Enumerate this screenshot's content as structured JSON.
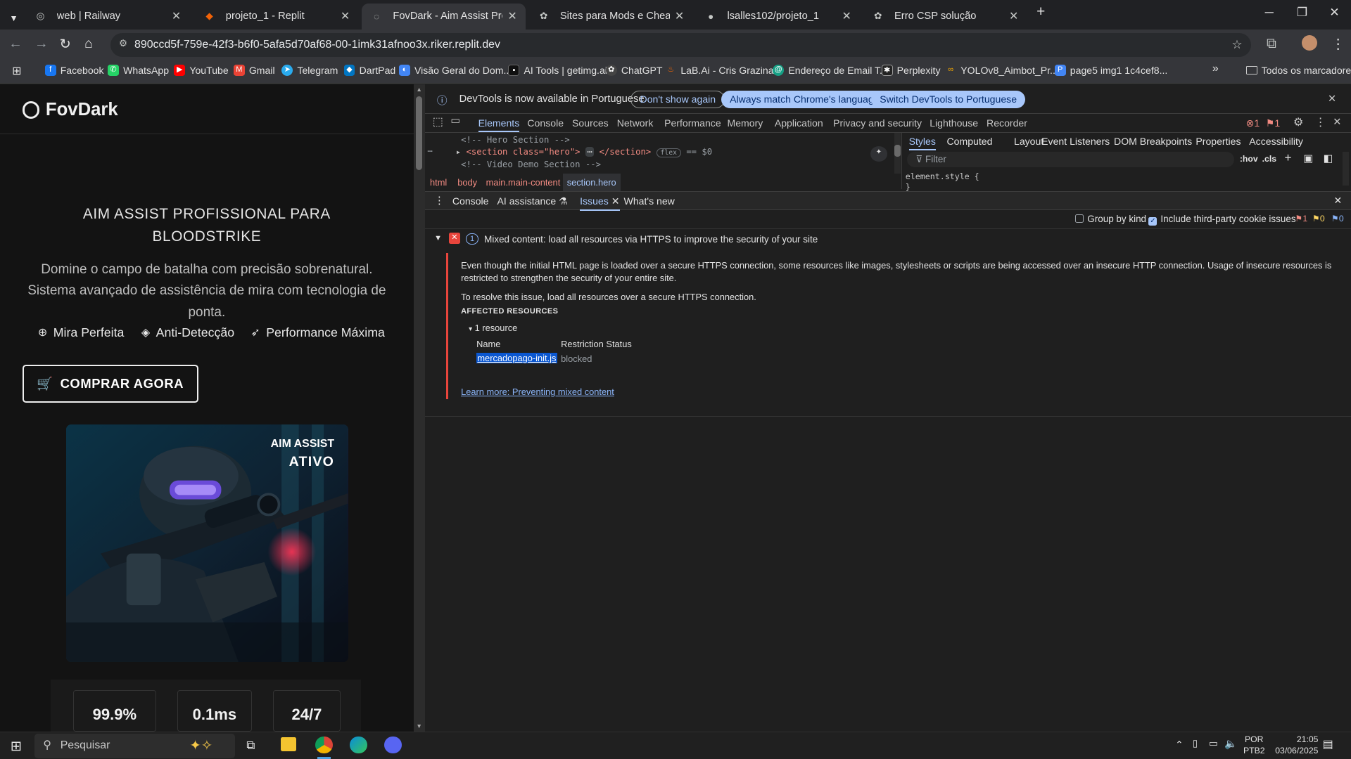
{
  "browser": {
    "tabs": [
      {
        "title": "web | Railway",
        "icon": "railway-icon"
      },
      {
        "title": "projeto_1 - Replit",
        "icon": "replit-icon"
      },
      {
        "title": "FovDark - Aim Assist Profission...",
        "icon": "globe-icon",
        "active": true
      },
      {
        "title": "Sites para Mods e Cheats",
        "icon": "chatgpt-icon"
      },
      {
        "title": "lsalles102/projeto_1",
        "icon": "github-icon"
      },
      {
        "title": "Erro CSP solução",
        "icon": "chatgpt-icon"
      }
    ],
    "url": "890ccd5f-759e-42f3-b6f0-5afa5d70af68-00-1imk31afnoo3x.riker.replit.dev",
    "bookmarks": [
      "Facebook",
      "WhatsApp",
      "YouTube",
      "Gmail",
      "Telegram",
      "DartPad",
      "Visão Geral do Dom...",
      "AI Tools | getimg.ai",
      "ChatGPT",
      "LaB.Ai - Cris Grazina...",
      "Endereço de Email T...",
      "Perplexity",
      "YOLOv8_Aimbot_Pr...",
      "page5 img1 1c4cef8...",
      "Todos os marcadores"
    ]
  },
  "site": {
    "logo": "FovDark",
    "hero_title": "AIM ASSIST PROFISSIONAL PARA BLOODSTRIKE",
    "hero_subtitle": "Domine o campo de batalha com precisão sobrenatural. Sistema avançado de assistência de mira com tecnologia de ponta.",
    "features": [
      "Mira Perfeita",
      "Anti-Detecção",
      "Performance Máxima"
    ],
    "buy_button": "COMPRAR AGORA",
    "image_overlay_line1": "AIM ASSIST",
    "image_overlay_line2": "ATIVO",
    "stats": [
      "99.9%",
      "0.1ms",
      "24/7"
    ]
  },
  "devtools": {
    "infobar_text": "DevTools is now available in Portuguese",
    "btn_dont_show": "Don't show again",
    "btn_match_lang": "Always match Chrome's language",
    "btn_switch": "Switch DevTools to Portuguese",
    "main_tabs": [
      "Elements",
      "Console",
      "Sources",
      "Network",
      "Performance",
      "Memory",
      "Application",
      "Privacy and security",
      "Lighthouse",
      "Recorder"
    ],
    "error_count": "1",
    "issue_count": "1",
    "dom_line1": "<!-- Hero Section -->",
    "dom_line2_tag": "<section class=\"hero\">",
    "dom_line2_end": "</section>",
    "dom_line2_badge": "flex",
    "dom_line2_eq": "== $0",
    "dom_line3": "<!-- Video Demo Section -->",
    "breadcrumbs": [
      "html",
      "body",
      "main.main-content",
      "section.hero"
    ],
    "style_tabs": [
      "Styles",
      "Computed",
      "Layout",
      "Event Listeners",
      "DOM Breakpoints",
      "Properties",
      "Accessibility"
    ],
    "filter_placeholder": "Filter",
    "hov": ":hov",
    "cls": ".cls",
    "element_style": "element.style {",
    "element_style_close": "}",
    "drawer_tabs": [
      "Console",
      "AI assistance",
      "Issues",
      "What's new"
    ],
    "group_by_kind": "Group by kind",
    "include_third_party": "Include third-party cookie issues",
    "badge_counts": [
      "1",
      "0",
      "0"
    ],
    "issue_count_badge": "1",
    "issue_title": "Mixed content: load all resources via HTTPS to improve the security of your site",
    "issue_body": "Even though the initial HTML page is loaded over a secure HTTPS connection, some resources like images, stylesheets or scripts are being accessed over an insecure HTTP connection. Usage of insecure resources is restricted to strengthen the security of your entire site.",
    "issue_resolve": "To resolve this issue, load all resources over a secure HTTPS connection.",
    "affected_label": "AFFECTED RESOURCES",
    "resource_count": "1 resource",
    "col_name": "Name",
    "col_status": "Restriction Status",
    "resource_name": "mercadopago-init.js",
    "resource_status": "blocked",
    "learn_more": "Learn more: Preventing mixed content"
  },
  "taskbar": {
    "search_placeholder": "Pesquisar",
    "lang_line1": "POR",
    "lang_line2": "PTB2",
    "time": "21:05",
    "date": "03/06/2025"
  }
}
